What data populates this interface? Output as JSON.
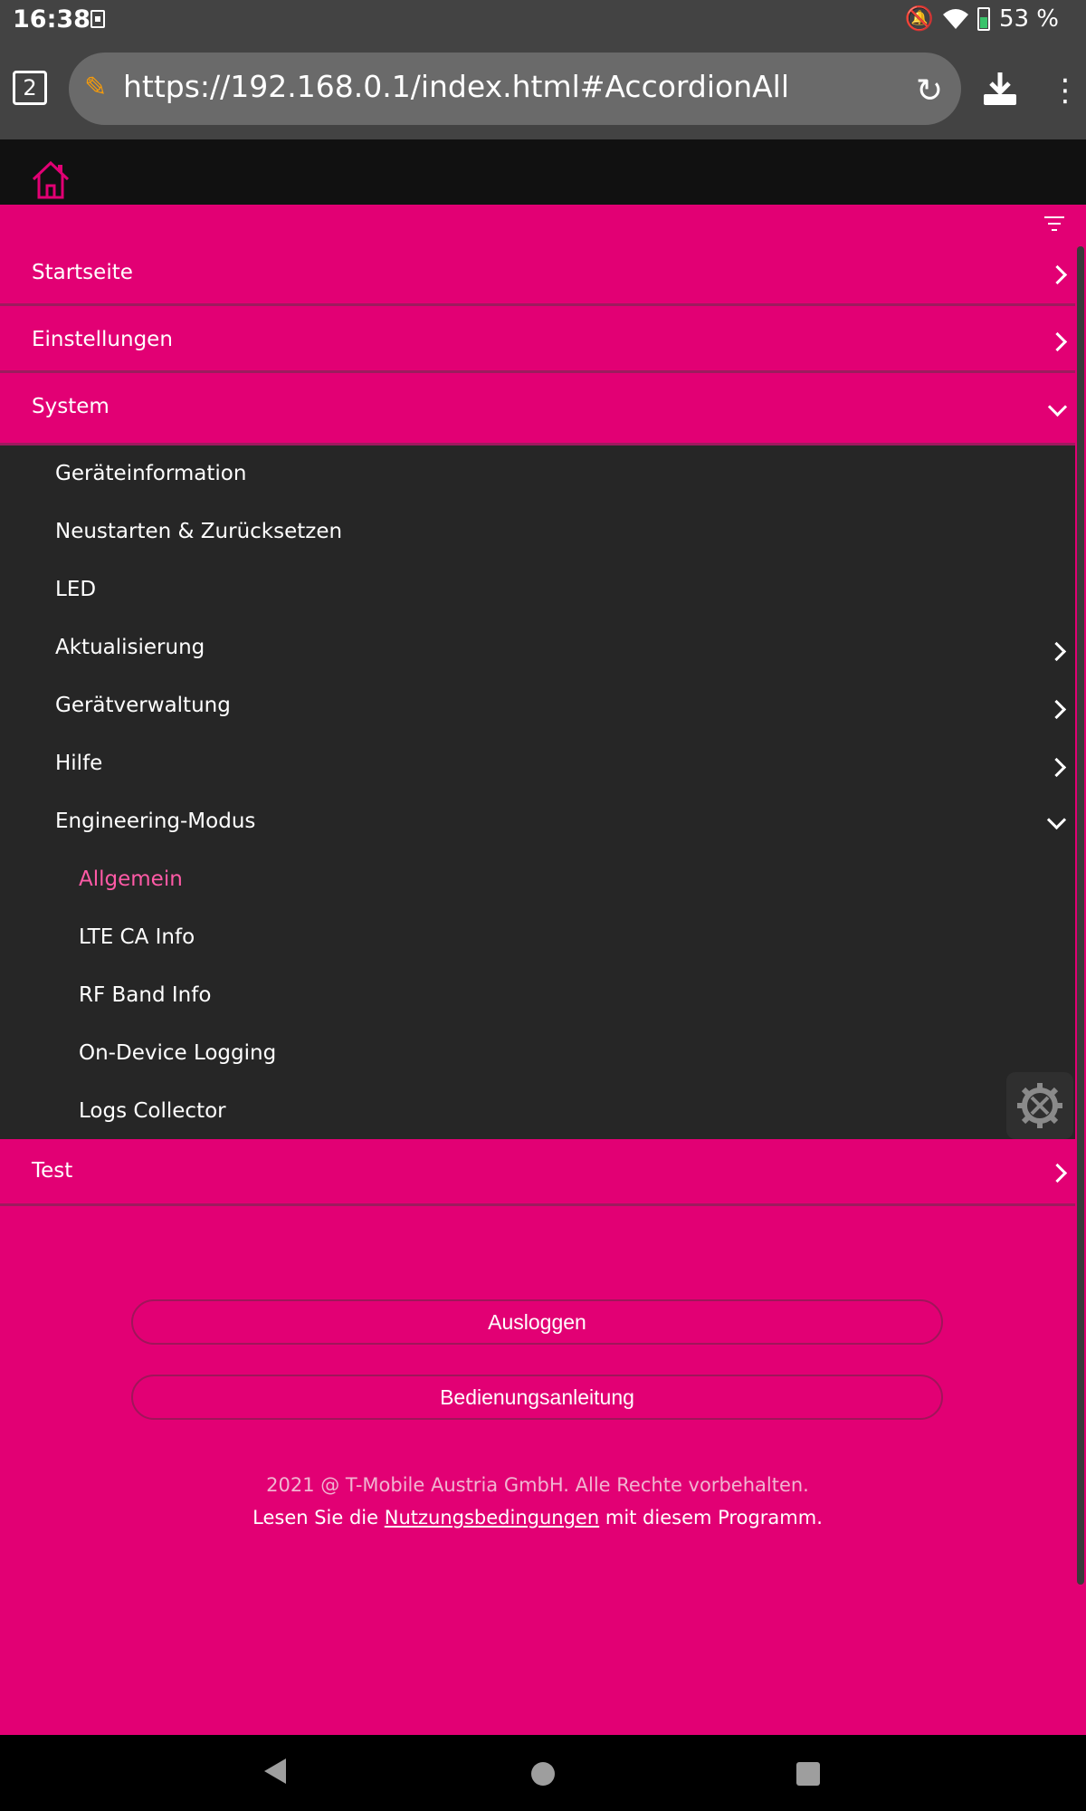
{
  "status_bar": {
    "time": "16:38",
    "battery": "53 %"
  },
  "browser": {
    "tab_count": "2",
    "url": "https://192.168.0.1/index.html#AccordionAll",
    "icons": [
      "warning-lock-icon",
      "reload-icon",
      "download-icon",
      "overflow-menu-icon"
    ]
  },
  "menu": {
    "items": [
      {
        "label": "Startseite",
        "state": "collapsed"
      },
      {
        "label": "Einstellungen",
        "state": "collapsed"
      },
      {
        "label": "System",
        "state": "expanded"
      }
    ],
    "system_sub": [
      {
        "label": "Geräteinformation"
      },
      {
        "label": "Neustarten & Zurücksetzen"
      },
      {
        "label": "LED"
      },
      {
        "label": "Aktualisierung"
      },
      {
        "label": "Gerätverwaltung"
      },
      {
        "label": "Hilfe"
      },
      {
        "label": "Engineering-Modus"
      }
    ],
    "engineering_sub": [
      {
        "label": "Allgemein",
        "active": true
      },
      {
        "label": "LTE CA Info"
      },
      {
        "label": "RF Band Info"
      },
      {
        "label": "On-Device Logging"
      },
      {
        "label": "Logs Collector"
      }
    ],
    "test_label": "Test"
  },
  "buttons": {
    "logout": "Ausloggen",
    "manual": "Bedienungsanleitung"
  },
  "footer": {
    "copyright": "2021 @ T-Mobile Austria GmbH. Alle Rechte vorbehalten.",
    "terms_prefix": "Lesen Sie die",
    "terms_link": "Nutzungsbedingungen",
    "terms_suffix": "mit diesem Programm."
  },
  "colors": {
    "brand": "#e20074",
    "submenu_bg": "#262626",
    "active_link": "#ff5aa6"
  }
}
